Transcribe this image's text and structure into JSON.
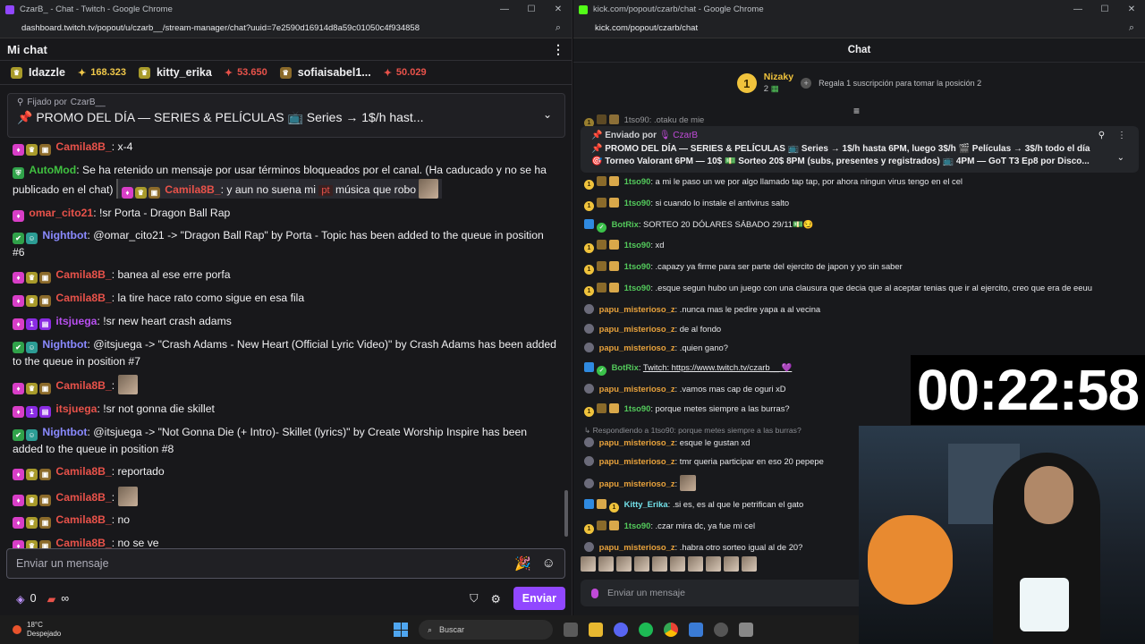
{
  "twitch": {
    "window_title": "CzarB_ - Chat - Twitch - Google Chrome",
    "url": "dashboard.twitch.tv/popout/u/czarb__/stream-manager/chat?uuid=7e2590d16914d8a59c01050c4f934858",
    "header_title": "Mi chat",
    "leaderboard": [
      {
        "name": "Idazzle",
        "amount": ""
      },
      {
        "name": "",
        "amount": "168.323",
        "style": "gold"
      },
      {
        "name": "kitty_erika",
        "amount": ""
      },
      {
        "name": "",
        "amount": "53.650",
        "style": "red"
      },
      {
        "name": "sofiaisabel1...",
        "amount": ""
      },
      {
        "name": "",
        "amount": "50.029",
        "style": "red"
      }
    ],
    "pinned": {
      "by_label": "Fijado por",
      "by_user": "CzarB__",
      "text": "📌 PROMO DEL DÍA — SERIES & PELÍCULAS 📺 Series → 1$/h hast..."
    },
    "messages": [
      {
        "user": "Camila8B_",
        "text": "x-4"
      },
      {
        "user": "AutoMod",
        "text": "Se ha retenido un mensaje por usar términos bloqueados por el canal. (Ha caducado y no se ha publicado en el chat)",
        "quote_user": "Camila8B_",
        "quote_text": "y aun no suena mi",
        "quote_tag": "pt",
        "quote_rest": "música que robo"
      },
      {
        "user": "omar_cito21",
        "text": "!sr Porta - Dragon Ball Rap"
      },
      {
        "user": "Nightbot",
        "text": "@omar_cito21 -> \"Dragon Ball Rap\" by Porta - Topic has been added to the queue in position #6"
      },
      {
        "user": "Camila8B_",
        "text": "banea al ese erre porfa"
      },
      {
        "user": "Camila8B_",
        "text": "la tire hace rato como sigue en esa fila"
      },
      {
        "user": "itsjuega",
        "text": "!sr new heart crash adams"
      },
      {
        "user": "Nightbot",
        "text": "@itsjuega -> \"Crash Adams - New Heart (Official Lyric Video)\" by Crash Adams has been added to the queue in position #7"
      },
      {
        "user": "Camila8B_",
        "text": ""
      },
      {
        "user": "itsjuega",
        "text": "!sr not gonna die skillet"
      },
      {
        "user": "Nightbot",
        "text": "@itsjuega -> \"Not Gonna Die (+ Intro)- Skillet (lyrics)\" by Create Worship Inspire has been added to the queue in position #8"
      },
      {
        "user": "Camila8B_",
        "text": "reportado"
      },
      {
        "user": "Camila8B_",
        "text": ""
      },
      {
        "user": "Camila8B_",
        "text": "no"
      },
      {
        "user": "Camila8B_",
        "text": "no se ve"
      }
    ],
    "input_placeholder": "Enviar un mensaje",
    "points": "0",
    "infinity": "∞",
    "send_label": "Enviar"
  },
  "kick": {
    "window_title": "kick.com/popout/czarb/chat - Google Chrome",
    "url": "kick.com/popout/czarb/chat",
    "header_title": "Chat",
    "gifter": {
      "rank": "1",
      "name": "Nizaky",
      "count": "2",
      "cta": "Regala 1 suscripción para tomar la posición 2"
    },
    "pinned": {
      "by_label": "Enviado por",
      "by_user": "CzarB",
      "line1": "📌 PROMO DEL DÍA — SERIES & PELÍCULAS 📺 Series → 1$/h hasta 6PM, luego 3$/h 🎬 Películas → 3$/h todo el día",
      "line2": "🎯 Torneo Valorant 6PM — 10$ 💵 Sorteo 20$ 8PM (subs, presentes y registrados) 📺 4PM — GoT T3 Ep8 por Disco..."
    },
    "messages": [
      {
        "user": "1tso90",
        "text": "a mi le paso un we por algo llamado tap tap, por ahora ningun virus tengo en el cel",
        "kind": "g"
      },
      {
        "user": "1tso90",
        "text": "si cuando lo instale el antivirus salto",
        "kind": "g"
      },
      {
        "user": "BotRix",
        "text": "SORTEO 20 DÓLARES SÁBADO 29/11💵😏",
        "kind": "bot"
      },
      {
        "user": "1tso90",
        "text": "xd",
        "kind": "g"
      },
      {
        "user": "1tso90",
        "text": ".capazy ya firme para ser parte del ejercito de japon y yo sin saber",
        "kind": "g"
      },
      {
        "user": "1tso90",
        "text": ".esque segun hubo un juego con una clausura que decia que al aceptar tenias que ir al ejercito, creo que era de eeuu",
        "kind": "g"
      },
      {
        "user": "papu_misterioso_z",
        "text": ".nunca mas le pedire yapa a al vecina",
        "kind": "o"
      },
      {
        "user": "papu_misterioso_z",
        "text": "de al fondo",
        "kind": "o"
      },
      {
        "user": "papu_misterioso_z",
        "text": ".quien gano?",
        "kind": "o"
      },
      {
        "user": "BotRix",
        "text": "Twitch: https://www.twitch.tv/czarb__ 💜",
        "kind": "bot"
      },
      {
        "user": "papu_misterioso_z",
        "text": ".vamos mas cap de oguri xD",
        "kind": "o"
      },
      {
        "user": "1tso90",
        "text": "porque metes siempre a las burras?",
        "kind": "g"
      },
      {
        "user": "papu_misterioso_z",
        "text": "esque le gustan xd",
        "kind": "o",
        "reply": "Respondiendo a 1tso90: porque metes siempre a las burras?"
      },
      {
        "user": "papu_misterioso_z",
        "text": "tmr queria participar en eso 20 pepepe",
        "kind": "o"
      },
      {
        "user": "papu_misterioso_z",
        "text": "",
        "kind": "o"
      },
      {
        "user": "Kitty_Erika",
        "text": ".si es, es al que le petrifican el gato",
        "kind": "c"
      },
      {
        "user": "1tso90",
        "text": ".czar mira dc, ya fue mi cel",
        "kind": "g"
      },
      {
        "user": "papu_misterioso_z",
        "text": ".habra otro sorteo igual al de 20?",
        "kind": "o"
      }
    ],
    "top_partial": "1tso90: .otaku de mie",
    "input_placeholder": "Enviar un mensaje"
  },
  "overlay": {
    "timer": "00:22:58"
  },
  "taskbar": {
    "temp": "18°C",
    "condition": "Despejado",
    "search": "Buscar"
  }
}
